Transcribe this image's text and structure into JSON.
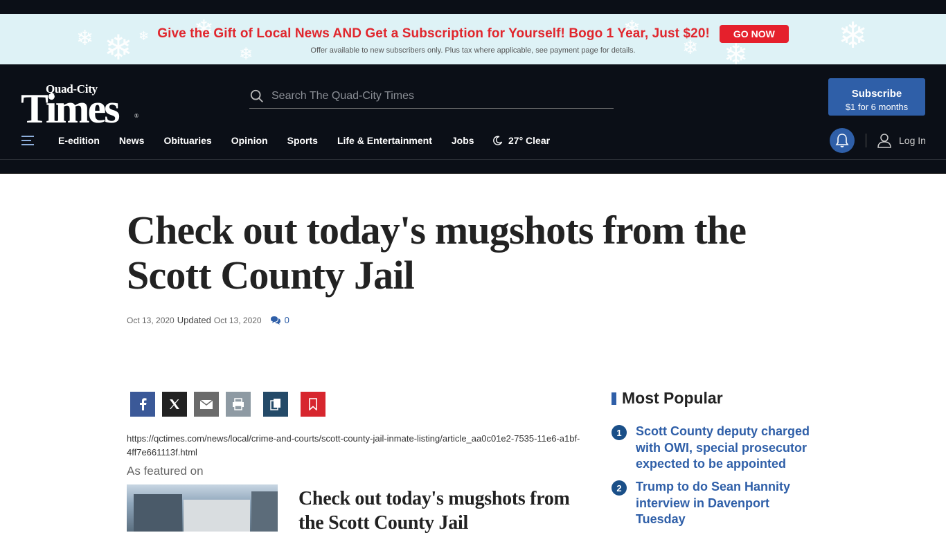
{
  "promo": {
    "headline": "Give the Gift of Local News AND Get a Subscription for Yourself! Bogo 1 Year, Just $20!",
    "button": "GO NOW",
    "fine_print": "Offer available to new subscribers only. Plus tax where applicable, see payment page for details."
  },
  "logo": {
    "small": "Quad-City",
    "big": "Times",
    "reg": "®"
  },
  "search": {
    "placeholder": "Search The Quad-City Times"
  },
  "subscribe": {
    "line1": "Subscribe",
    "line2": "$1 for 6 months"
  },
  "nav": {
    "items": [
      "E-edition",
      "News",
      "Obituaries",
      "Opinion",
      "Sports",
      "Life & Entertainment",
      "Jobs"
    ],
    "weather": "27° Clear",
    "login": "Log In"
  },
  "article": {
    "title": "Check out today's mugshots from the Scott County Jail",
    "date": "Oct 13, 2020",
    "updated_label": "Updated",
    "updated_date": "Oct 13, 2020",
    "comment_count": "0",
    "url": "https://qctimes.com/news/local/crime-and-courts/scott-county-jail-inmate-listing/article_aa0c01e2-7535-11e6-a1bf-4ff7e661113f.html",
    "featured_label": "As featured on",
    "featured_title": "Check out today's mugshots from the Scott County Jail"
  },
  "share": {
    "colors": {
      "facebook": "#3b5998",
      "x": "#222222",
      "email": "#6b6b6b",
      "print": "#8e9aa3",
      "copy": "#244a68",
      "save": "#d7262e"
    }
  },
  "popular": {
    "title": "Most Popular",
    "items": [
      {
        "num": "1",
        "text": "Scott County deputy charged with OWI, special prosecutor expected to be appointed"
      },
      {
        "num": "2",
        "text": "Trump to do Sean Hannity interview in Davenport Tuesday"
      }
    ]
  },
  "colors": {
    "header_bg": "#0b0f17",
    "accent_blue": "#2f5fa8",
    "promo_red": "#e0262d",
    "promo_bg": "#def2f6"
  }
}
